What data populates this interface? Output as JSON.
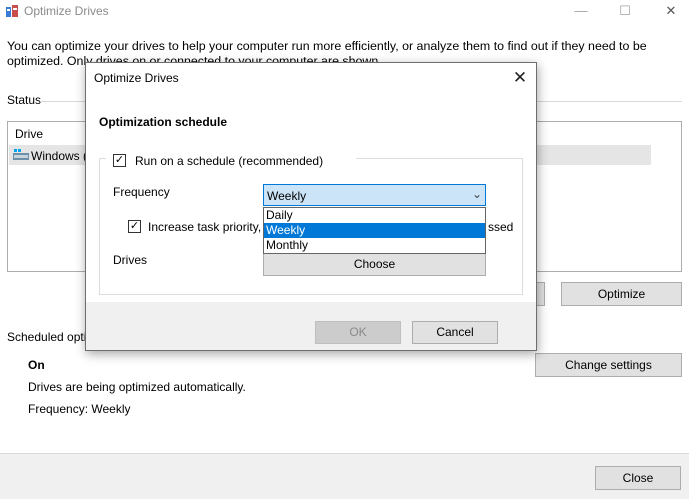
{
  "window": {
    "title": "Optimize Drives",
    "minimize": "—",
    "maximize": "☐",
    "close": "✕"
  },
  "intro": "You can optimize your drives to help your computer run more efficiently, or analyze them to find out if they need to be optimized. Only drives on or connected to your computer are shown.",
  "status": {
    "label": "Status",
    "column_drive": "Drive",
    "drive_name": "Windows ("
  },
  "buttons": {
    "optimize": "Optimize",
    "change_settings": "Change settings",
    "close": "Close"
  },
  "scheduled": {
    "label": "Scheduled opti",
    "state": "On",
    "description": "Drives are being optimized automatically.",
    "frequency": "Frequency: Weekly"
  },
  "dialog": {
    "title": "Optimize Drives",
    "close": "✕",
    "section": "Optimization schedule",
    "run_schedule": "Run on a schedule (recommended)",
    "frequency_label": "Frequency",
    "frequency_value": "Weekly",
    "options": [
      "Daily",
      "Weekly",
      "Monthly"
    ],
    "selected_option": "Weekly",
    "increase_priority": "Increase task priority,",
    "increase_priority_tail": "ssed",
    "drives_label": "Drives",
    "choose": "Choose",
    "ok": "OK",
    "cancel": "Cancel",
    "check": "✓",
    "arrow": "⌄"
  },
  "colors": {
    "accent": "#0078d7",
    "combo_bg": "#cce4f7"
  }
}
